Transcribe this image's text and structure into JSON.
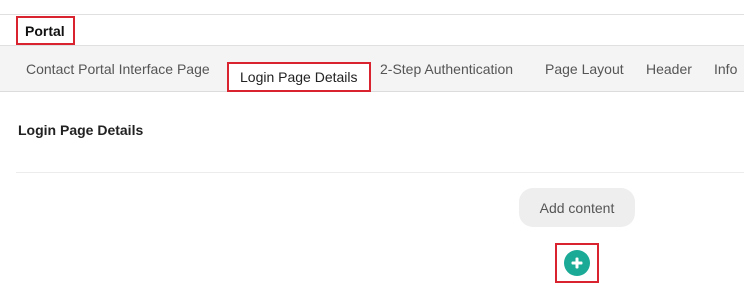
{
  "header": {
    "title": "Portal"
  },
  "tabs": [
    {
      "label": "Contact Portal Interface Page",
      "active": false
    },
    {
      "label": "Login Page Details",
      "active": true
    },
    {
      "label": "2-Step Authentication",
      "active": false
    },
    {
      "label": "Page Layout",
      "active": false
    },
    {
      "label": "Header",
      "active": false
    },
    {
      "label": "Info",
      "active": false
    }
  ],
  "main": {
    "section_title": "Login Page Details",
    "add_content_label": "Add content",
    "add_icon": "plus-icon"
  },
  "colors": {
    "highlight": "#d9232e",
    "add_button": "#1aaa96"
  }
}
